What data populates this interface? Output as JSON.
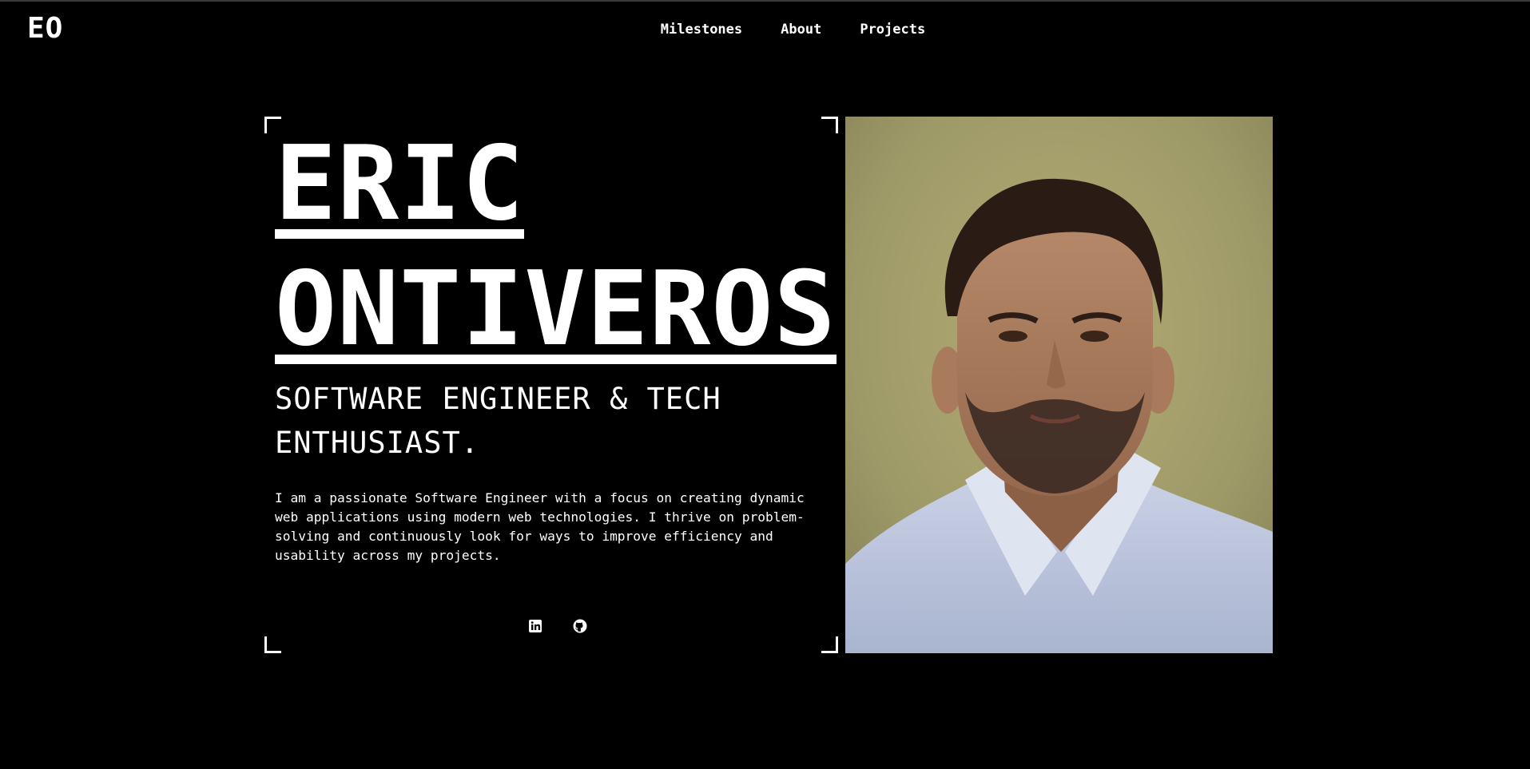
{
  "header": {
    "logo": "EO",
    "nav": [
      {
        "label": "Milestones"
      },
      {
        "label": "About"
      },
      {
        "label": "Projects"
      }
    ]
  },
  "hero": {
    "first_name": "ERIC",
    "last_name": "ONTIVEROS",
    "tagline": "SOFTWARE ENGINEER & TECH ENTHUSIAST.",
    "bio": "I am a passionate Software Engineer with a focus on creating dynamic web applications using modern web technologies. I thrive on problem-solving and continuously look for ways to improve efficiency and usability across my projects.",
    "socials": [
      {
        "icon": "linkedin-icon"
      },
      {
        "icon": "github-icon"
      }
    ],
    "photo": {
      "icon": "portrait-photo"
    }
  },
  "colors": {
    "background": "#000000",
    "text": "#ffffff",
    "photo_background": "#a39f6c"
  }
}
